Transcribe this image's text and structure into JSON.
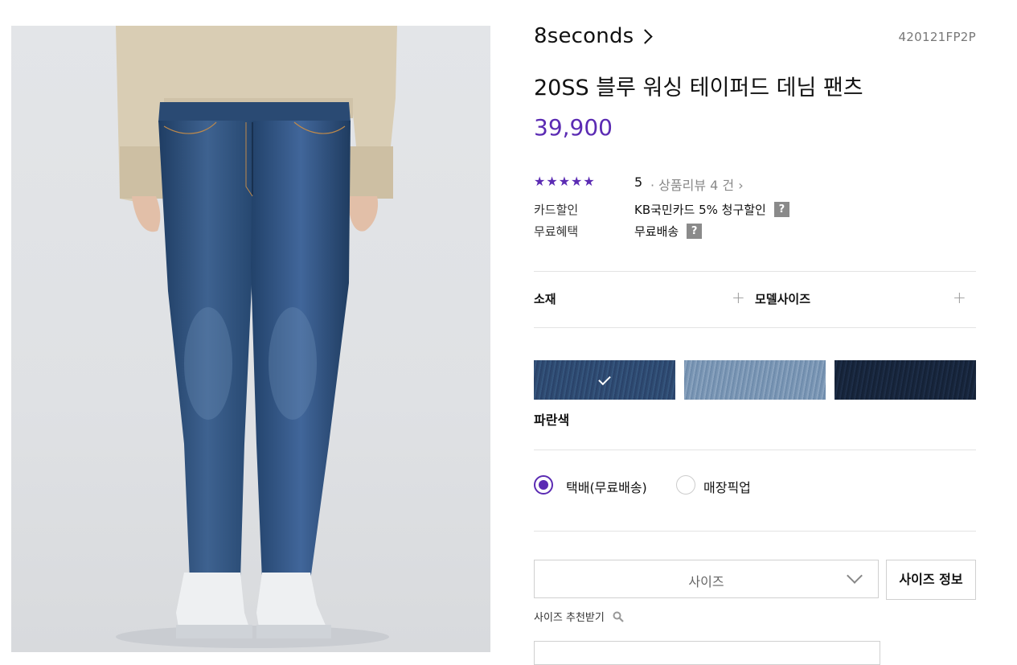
{
  "product": {
    "brand": "8seconds",
    "code": "420121FP2P",
    "title": "20SS 블루 워싱 테이퍼드 데님 팬츠",
    "price": "39,900",
    "rating": "5",
    "reviews": "· 상품리뷰 4 건 ›",
    "rating_value": 5,
    "rating_max": 5
  },
  "benefits": [
    {
      "label": "카드할인",
      "value": "KB국민카드 5% 청구할인",
      "help": "?"
    },
    {
      "label": "무료혜택",
      "value": "무료배송",
      "help": "?"
    }
  ],
  "accordion": {
    "material": "소재",
    "model_size": "모델사이즈",
    "plus": "+"
  },
  "colors": {
    "selected_name": "파란색",
    "swatches": [
      {
        "name": "blue",
        "hex": "#2f4b72",
        "selected": true
      },
      {
        "name": "light-blue",
        "hex": "#7f99b6",
        "selected": false
      },
      {
        "name": "navy",
        "hex": "#19273e",
        "selected": false
      }
    ]
  },
  "delivery": {
    "options": [
      {
        "label": "택배(무료배송)",
        "selected": true
      },
      {
        "label": "매장픽업",
        "selected": false
      }
    ]
  },
  "size": {
    "placeholder": "사이즈",
    "info_button": "사이즈 정보",
    "recommend": "사이즈 추천받기"
  },
  "colors_theme": {
    "accent": "#5b2bb3",
    "text": "#111111",
    "muted": "#888888"
  }
}
